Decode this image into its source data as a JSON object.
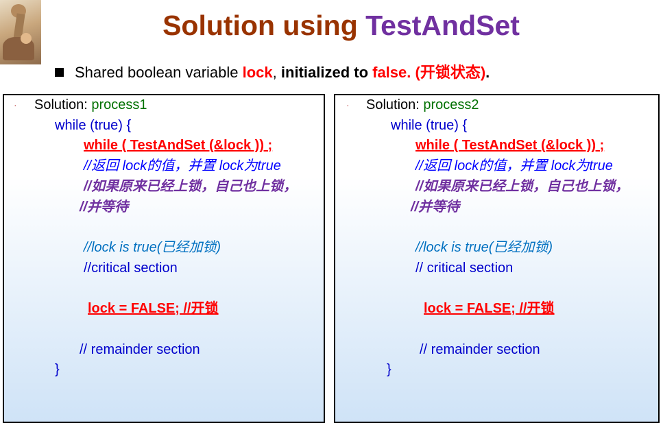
{
  "header": {
    "title_part1": "Solution using ",
    "title_part2": "TestAndSet"
  },
  "bullet": {
    "text1": "Shared boolean variable ",
    "lock": "lock",
    "comma": ", ",
    "init": "initialized to ",
    "false_val": "false.",
    "cn": "  (开锁状态)",
    "end": "."
  },
  "panels": [
    {
      "label": "Solution: ",
      "process": "process1",
      "while_true": "while (true) {",
      "test_and_set": "while ( TestAndSet (&lock ))  ;",
      "comment1": "//返回 lock的值，并置 lock为true",
      "comment2": "//如果原来已经上锁，自己也上锁，",
      "comment3": "//并等待",
      "comment4": "//lock is true(已经加锁)",
      "critical": "//critical section",
      "unlock": "  lock = FALSE;   //开锁",
      "remainder": "// remainder section",
      "close": "}"
    },
    {
      "label": "Solution: ",
      "process": "process2",
      "while_true": "while (true) {",
      "test_and_set": "while ( TestAndSet (&lock )) ;",
      "comment1": "//返回 lock的值，并置 lock为true",
      "comment2": "//如果原来已经上锁，自己也上锁，",
      "comment3": "//并等待",
      "comment4": "//lock is true(已经加锁)",
      "critical": "// critical section",
      "unlock": " lock = FALSE;   //开锁",
      "remainder": "// remainder section",
      "close": "}"
    }
  ]
}
